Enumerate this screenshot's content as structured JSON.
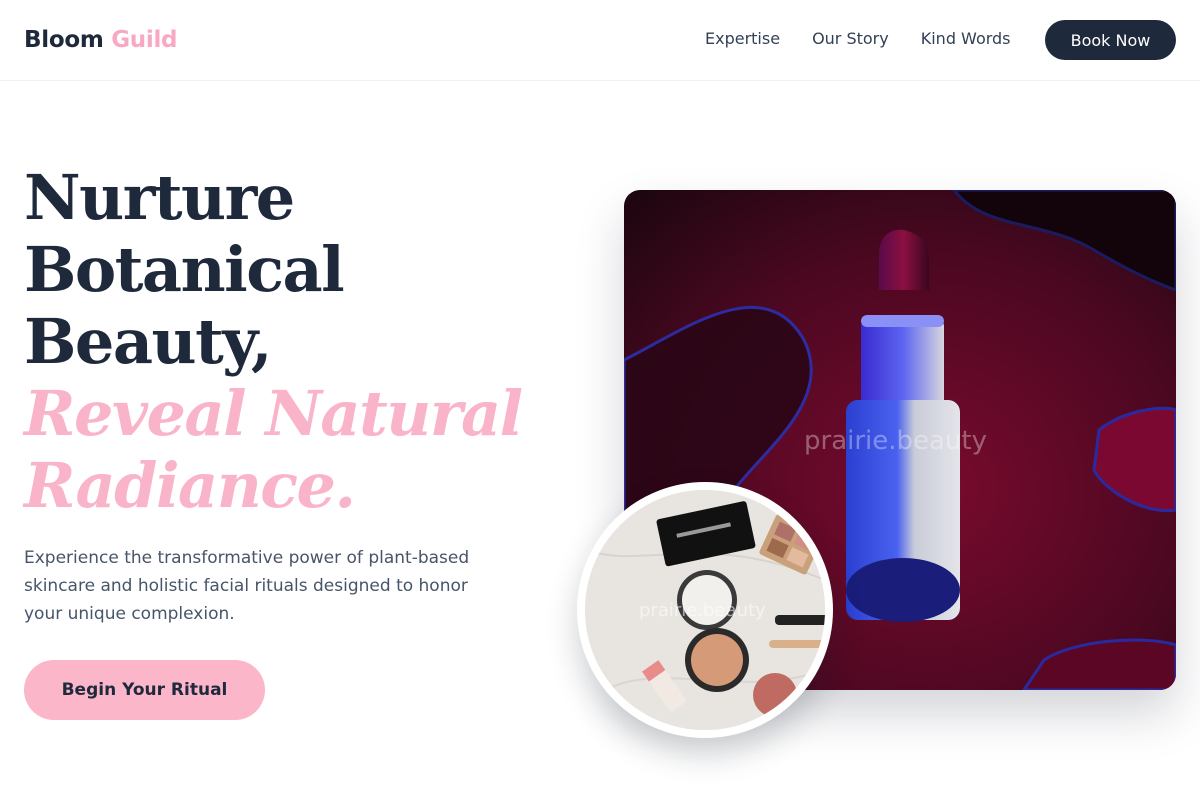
{
  "brand": {
    "first": "Bloom",
    "second": "Guild"
  },
  "nav": {
    "items": [
      {
        "label": "Expertise"
      },
      {
        "label": "Our Story"
      },
      {
        "label": "Kind Words"
      }
    ],
    "cta_label": "Book Now"
  },
  "hero": {
    "headline_lines": [
      "Nurture",
      "Botanical",
      "Beauty,"
    ],
    "accent_lines": [
      "Reveal Natural",
      "Radiance."
    ],
    "description": "Experience the transformative power of plant-based skincare and holistic facial rituals designed to honor your unique complexion.",
    "cta_label": "Begin Your Ritual"
  },
  "images": {
    "main_watermark": "prairie.beauty",
    "secondary_watermark": "prairie.beauty"
  },
  "colors": {
    "navy": "#1e293b",
    "pink_accent": "#f9b4c9",
    "cta_pink": "#fbb6c9"
  }
}
